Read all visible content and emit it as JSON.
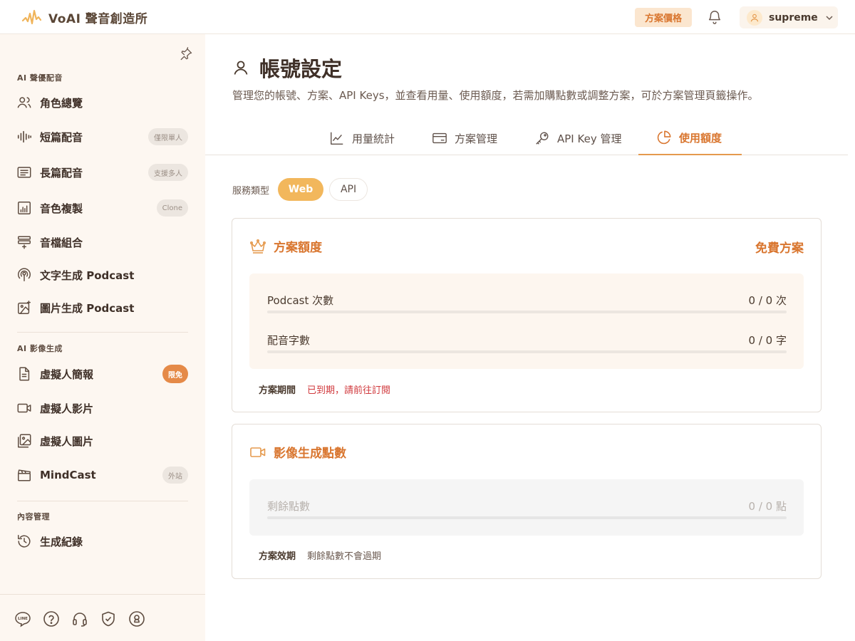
{
  "brand": {
    "name": "VoAI 聲音創造所"
  },
  "header": {
    "pricing_label": "方案價格",
    "username": "supreme"
  },
  "sidebar": {
    "sections": {
      "voice": "AI 聲優配音",
      "video": "AI 影像生成",
      "content": "內容管理"
    },
    "items": [
      {
        "label": "角色總覽",
        "icon": "users-icon"
      },
      {
        "label": "短篇配音",
        "icon": "waveform-icon",
        "badge": "僅限單人"
      },
      {
        "label": "長篇配音",
        "icon": "document-lines-icon",
        "badge": "支援多人"
      },
      {
        "label": "音色複製",
        "icon": "voice-clone-icon",
        "badge": "Clone"
      },
      {
        "label": "音檔組合",
        "icon": "audio-merge-icon"
      },
      {
        "label": "文字生成 Podcast",
        "icon": "podcast-icon"
      },
      {
        "label": "圖片生成 Podcast",
        "icon": "image-sparkle-icon"
      },
      {
        "label": "虛擬人簡報",
        "icon": "file-icon",
        "badge": "限免"
      },
      {
        "label": "虛擬人影片",
        "icon": "video-icon"
      },
      {
        "label": "虛擬人圖片",
        "icon": "image-icon"
      },
      {
        "label": "MindCast",
        "icon": "clapper-icon",
        "badge": "外站"
      },
      {
        "label": "生成紀錄",
        "icon": "history-icon"
      }
    ]
  },
  "page": {
    "title": "帳號設定",
    "description": "管理您的帳號、方案、API Keys，並查看用量、使用額度，若需加購點數或調整方案，可於方案管理頁籤操作。",
    "tabs": [
      {
        "label": "用量統計",
        "icon": "line-chart-icon"
      },
      {
        "label": "方案管理",
        "icon": "card-icon"
      },
      {
        "label": "API Key 管理",
        "icon": "key-icon"
      },
      {
        "label": "使用額度",
        "icon": "pie-chart-icon",
        "active": true
      }
    ],
    "service_type": {
      "label": "服務類型",
      "options": [
        "Web",
        "API"
      ],
      "selected": "Web"
    }
  },
  "plan_card": {
    "title": "方案額度",
    "plan_name": "免費方案",
    "meters": [
      {
        "name": "Podcast 次數",
        "value": "0 / 0 次",
        "used_fraction": 0
      },
      {
        "name": "配音字數",
        "value": "0 / 0 字",
        "used_fraction": 0
      }
    ],
    "period_label": "方案期間",
    "period_value": "已到期，請前往訂閱"
  },
  "video_card": {
    "title": "影像生成點數",
    "meters": [
      {
        "name": "剩餘點數",
        "value": "0 / 0 點",
        "used_fraction": 0
      }
    ],
    "validity_label": "方案效期",
    "validity_value": "剩餘點數不會過期"
  },
  "colors": {
    "accent": "#d9762f",
    "accent_light": "#f2b75c",
    "sidebar_bg": "#fdf7f1",
    "error": "#d0383c"
  }
}
